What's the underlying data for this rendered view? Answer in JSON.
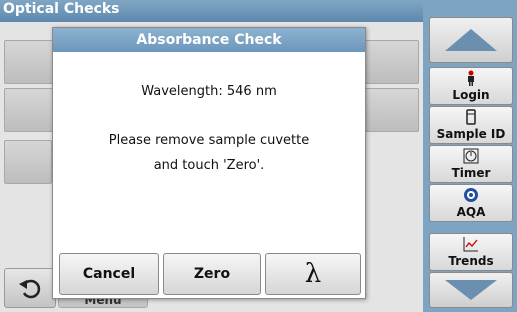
{
  "screen": {
    "title": "Optical Checks",
    "menu_label": "Menu"
  },
  "dialog": {
    "title": "Absorbance Check",
    "wavelength_text": "Wavelength: 546 nm",
    "instruction_line1": "Please remove sample cuvette",
    "instruction_line2": "and touch 'Zero'.",
    "buttons": {
      "cancel": "Cancel",
      "zero": "Zero",
      "lambda": "λ"
    }
  },
  "sidebar": {
    "items": [
      {
        "label": "Login",
        "icon": "person-icon"
      },
      {
        "label": "Sample ID",
        "icon": "cuvette-icon"
      },
      {
        "label": "Timer",
        "icon": "timer-icon"
      },
      {
        "label": "AQA",
        "icon": "aqa-icon"
      },
      {
        "label": "Trends",
        "icon": "trends-icon"
      }
    ]
  },
  "colors": {
    "header_blue": "#7da4c3",
    "dialog_title_blue": "#6c97bb"
  }
}
